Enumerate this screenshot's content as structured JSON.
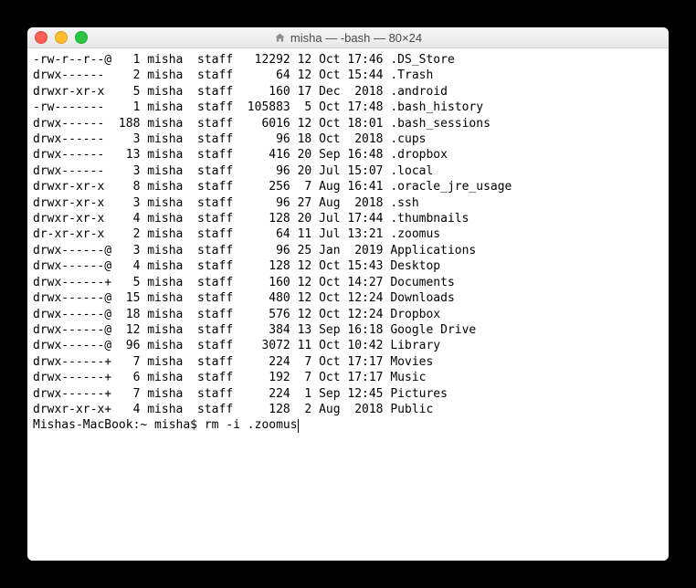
{
  "window": {
    "title": "misha — -bash — 80×24"
  },
  "listing": [
    {
      "perms": "-rw-r--r--@",
      "links": "1",
      "owner": "misha",
      "group": "staff",
      "size": "12292",
      "day": "12",
      "mon": "Oct",
      "time": "17:46",
      "name": ".DS_Store"
    },
    {
      "perms": "drwx------ ",
      "links": "2",
      "owner": "misha",
      "group": "staff",
      "size": "64",
      "day": "12",
      "mon": "Oct",
      "time": "15:44",
      "name": ".Trash"
    },
    {
      "perms": "drwxr-xr-x ",
      "links": "5",
      "owner": "misha",
      "group": "staff",
      "size": "160",
      "day": "17",
      "mon": "Dec",
      "time": " 2018",
      "name": ".android"
    },
    {
      "perms": "-rw------- ",
      "links": "1",
      "owner": "misha",
      "group": "staff",
      "size": "105883",
      "day": " 5",
      "mon": "Oct",
      "time": "17:48",
      "name": ".bash_history"
    },
    {
      "perms": "drwx------ ",
      "links": "188",
      "owner": "misha",
      "group": "staff",
      "size": "6016",
      "day": "12",
      "mon": "Oct",
      "time": "18:01",
      "name": ".bash_sessions"
    },
    {
      "perms": "drwx------ ",
      "links": "3",
      "owner": "misha",
      "group": "staff",
      "size": "96",
      "day": "18",
      "mon": "Oct",
      "time": " 2018",
      "name": ".cups"
    },
    {
      "perms": "drwx------ ",
      "links": "13",
      "owner": "misha",
      "group": "staff",
      "size": "416",
      "day": "20",
      "mon": "Sep",
      "time": "16:48",
      "name": ".dropbox"
    },
    {
      "perms": "drwx------ ",
      "links": "3",
      "owner": "misha",
      "group": "staff",
      "size": "96",
      "day": "20",
      "mon": "Jul",
      "time": "15:07",
      "name": ".local"
    },
    {
      "perms": "drwxr-xr-x ",
      "links": "8",
      "owner": "misha",
      "group": "staff",
      "size": "256",
      "day": " 7",
      "mon": "Aug",
      "time": "16:41",
      "name": ".oracle_jre_usage"
    },
    {
      "perms": "drwxr-xr-x ",
      "links": "3",
      "owner": "misha",
      "group": "staff",
      "size": "96",
      "day": "27",
      "mon": "Aug",
      "time": " 2018",
      "name": ".ssh"
    },
    {
      "perms": "drwxr-xr-x ",
      "links": "4",
      "owner": "misha",
      "group": "staff",
      "size": "128",
      "day": "20",
      "mon": "Jul",
      "time": "17:44",
      "name": ".thumbnails"
    },
    {
      "perms": "dr-xr-xr-x ",
      "links": "2",
      "owner": "misha",
      "group": "staff",
      "size": "64",
      "day": "11",
      "mon": "Jul",
      "time": "13:21",
      "name": ".zoomus"
    },
    {
      "perms": "drwx------@",
      "links": "3",
      "owner": "misha",
      "group": "staff",
      "size": "96",
      "day": "25",
      "mon": "Jan",
      "time": " 2019",
      "name": "Applications"
    },
    {
      "perms": "drwx------@",
      "links": "4",
      "owner": "misha",
      "group": "staff",
      "size": "128",
      "day": "12",
      "mon": "Oct",
      "time": "15:43",
      "name": "Desktop"
    },
    {
      "perms": "drwx------+",
      "links": "5",
      "owner": "misha",
      "group": "staff",
      "size": "160",
      "day": "12",
      "mon": "Oct",
      "time": "14:27",
      "name": "Documents"
    },
    {
      "perms": "drwx------@",
      "links": "15",
      "owner": "misha",
      "group": "staff",
      "size": "480",
      "day": "12",
      "mon": "Oct",
      "time": "12:24",
      "name": "Downloads"
    },
    {
      "perms": "drwx------@",
      "links": "18",
      "owner": "misha",
      "group": "staff",
      "size": "576",
      "day": "12",
      "mon": "Oct",
      "time": "12:24",
      "name": "Dropbox"
    },
    {
      "perms": "drwx------@",
      "links": "12",
      "owner": "misha",
      "group": "staff",
      "size": "384",
      "day": "13",
      "mon": "Sep",
      "time": "16:18",
      "name": "Google Drive"
    },
    {
      "perms": "drwx------@",
      "links": "96",
      "owner": "misha",
      "group": "staff",
      "size": "3072",
      "day": "11",
      "mon": "Oct",
      "time": "10:42",
      "name": "Library"
    },
    {
      "perms": "drwx------+",
      "links": "7",
      "owner": "misha",
      "group": "staff",
      "size": "224",
      "day": " 7",
      "mon": "Oct",
      "time": "17:17",
      "name": "Movies"
    },
    {
      "perms": "drwx------+",
      "links": "6",
      "owner": "misha",
      "group": "staff",
      "size": "192",
      "day": " 7",
      "mon": "Oct",
      "time": "17:17",
      "name": "Music"
    },
    {
      "perms": "drwx------+",
      "links": "7",
      "owner": "misha",
      "group": "staff",
      "size": "224",
      "day": " 1",
      "mon": "Sep",
      "time": "12:45",
      "name": "Pictures"
    },
    {
      "perms": "drwxr-xr-x+",
      "links": "4",
      "owner": "misha",
      "group": "staff",
      "size": "128",
      "day": " 2",
      "mon": "Aug",
      "time": " 2018",
      "name": "Public"
    }
  ],
  "prompt": {
    "prefix": "Mishas-MacBook:~ misha$ ",
    "command": "rm -i .zoomus"
  }
}
